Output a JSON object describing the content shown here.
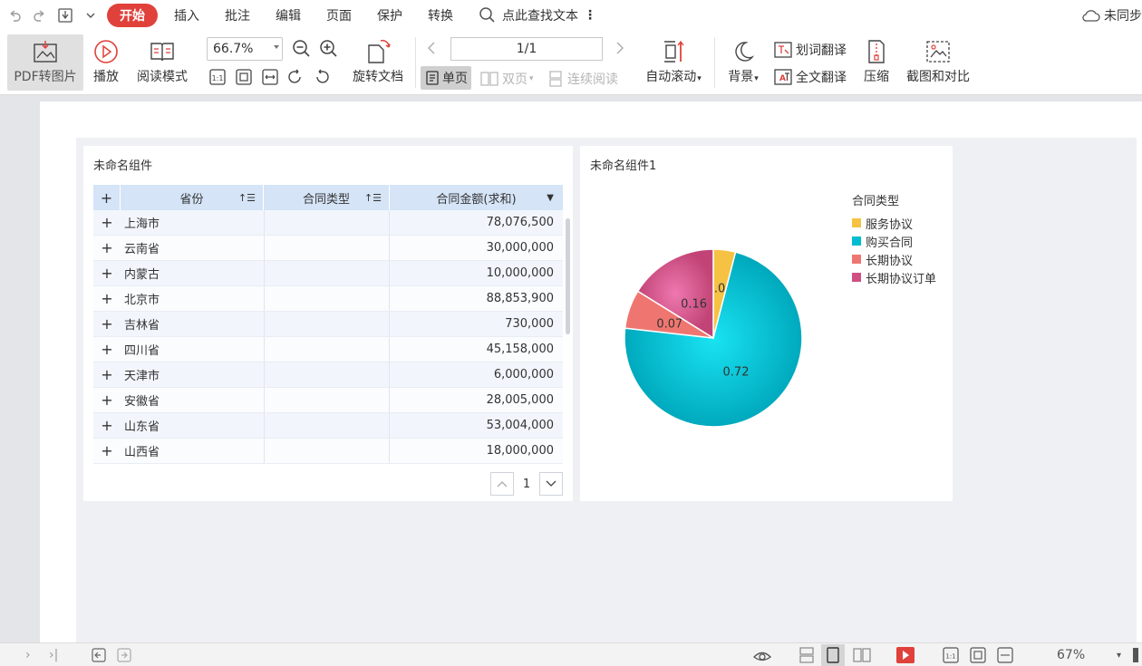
{
  "menubar": {
    "tabs": [
      {
        "label": "开始",
        "active": true
      },
      {
        "label": "插入"
      },
      {
        "label": "批注"
      },
      {
        "label": "编辑"
      },
      {
        "label": "页面"
      },
      {
        "label": "保护"
      },
      {
        "label": "转换"
      }
    ],
    "search_label": "点此查找文本",
    "sync_label": "未同步"
  },
  "toolbar": {
    "pdf_to_image": "PDF转图片",
    "play": "播放",
    "read_mode": "阅读模式",
    "zoom": "66.7%",
    "rotate_doc": "旋转文档",
    "page_indicator": "1/1",
    "single_page": "单页",
    "double_page": "双页",
    "continuous": "连续阅读",
    "auto_scroll": "自动滚动",
    "background": "背景",
    "word_translate": "划词翻译",
    "full_translate": "全文翻译",
    "compress": "压缩",
    "screenshot_compare": "截图和对比"
  },
  "table_widget": {
    "title": "未命名组件",
    "headers": {
      "province": "省份",
      "contract_type": "合同类型",
      "amount": "合同金额(求和)"
    },
    "rows": [
      {
        "province": "上海市",
        "amount": "78,076,500"
      },
      {
        "province": "云南省",
        "amount": "30,000,000"
      },
      {
        "province": "内蒙古",
        "amount": "10,000,000"
      },
      {
        "province": "北京市",
        "amount": "88,853,900"
      },
      {
        "province": "吉林省",
        "amount": "730,000"
      },
      {
        "province": "四川省",
        "amount": "45,158,000"
      },
      {
        "province": "天津市",
        "amount": "6,000,000"
      },
      {
        "province": "安徽省",
        "amount": "28,005,000"
      },
      {
        "province": "山东省",
        "amount": "53,004,000"
      },
      {
        "province": "山西省",
        "amount": "18,000,000"
      }
    ],
    "page_number": "1"
  },
  "chart_widget": {
    "title": "未命名组件1"
  },
  "chart_data": {
    "type": "pie",
    "legend_title": "合同类型",
    "legend_position": "top-right",
    "slices": [
      {
        "name": "服务协议",
        "value": 0.04,
        "label": "0.04",
        "color": "#f6c244"
      },
      {
        "name": "购买合同",
        "value": 0.72,
        "label": "0.72",
        "color": "#00bcd0"
      },
      {
        "name": "长期协议",
        "value": 0.07,
        "label": "0.07",
        "color": "#ef7670"
      },
      {
        "name": "长期协议订单",
        "value": 0.16,
        "label": "0.16",
        "color": "#cf4f83"
      }
    ]
  },
  "statusbar": {
    "zoom": "67%"
  },
  "colors": {
    "accent": "#e0413b",
    "table_header": "#d5e4f7"
  }
}
